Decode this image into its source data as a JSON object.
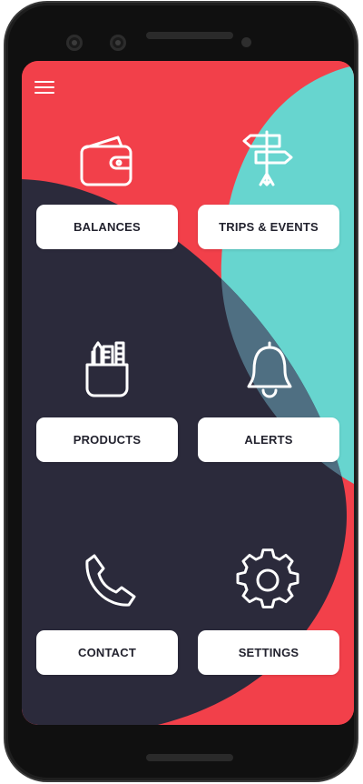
{
  "colors": {
    "red": "#F2404A",
    "dark": "#2B2A3B",
    "teal": "#67D5CF",
    "overlap": "#4F6F82",
    "button_text": "#22222E"
  },
  "menu": {
    "icon": "hamburger-menu-icon"
  },
  "tiles": [
    {
      "label": "BALANCES",
      "icon": "wallet-icon"
    },
    {
      "label": "TRIPS & EVENTS",
      "icon": "signpost-icon"
    },
    {
      "label": "PRODUCTS",
      "icon": "pencil-cup-icon"
    },
    {
      "label": "ALERTS",
      "icon": "bell-icon"
    },
    {
      "label": "CONTACT",
      "icon": "phone-icon"
    },
    {
      "label": "SETTINGS",
      "icon": "gear-icon"
    }
  ]
}
